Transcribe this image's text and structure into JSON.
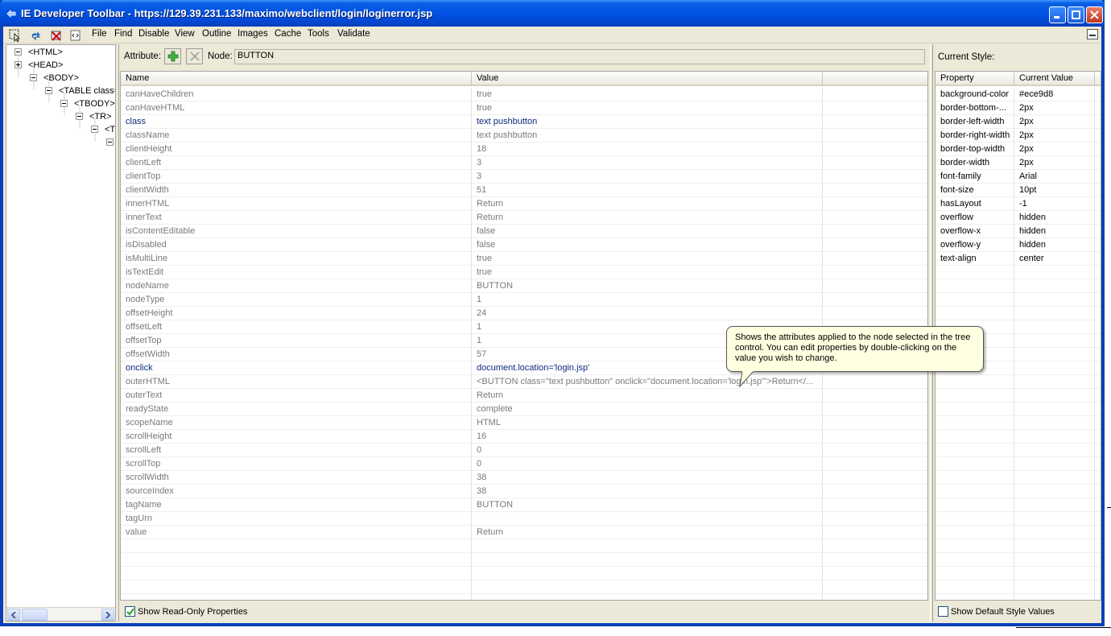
{
  "window": {
    "title": "IE Developer Toolbar - https://129.39.231.133/maximo/webclient/login/loginerror.jsp"
  },
  "menu": {
    "icons": [
      "select-element-icon",
      "refresh-icon",
      "clear-cache-icon",
      "view-source-icon"
    ],
    "items": [
      "File",
      "Find",
      "Disable",
      "View",
      "Outline",
      "Images",
      "Cache",
      "Tools",
      "Validate"
    ]
  },
  "tree": {
    "nodes": [
      {
        "label": "<HTML>",
        "toggle": "minus"
      },
      {
        "label": "<HEAD>",
        "toggle": "plus"
      },
      {
        "label": "<BODY>",
        "toggle": "minus"
      },
      {
        "label": "<TABLE class=",
        "toggle": "minus"
      },
      {
        "label": "<TBODY>",
        "toggle": "minus"
      },
      {
        "label": "<TR>",
        "toggle": "minus"
      },
      {
        "label": "<T",
        "toggle": "minus"
      },
      {
        "label": "",
        "toggle": "minus"
      }
    ]
  },
  "attributes": {
    "attribute_label": "Attribute:",
    "node_label": "Node:",
    "node_value": "BUTTON",
    "columns": [
      "Name",
      "Value"
    ],
    "rows": [
      {
        "name": "canHaveChildren",
        "value": "true",
        "editable": false
      },
      {
        "name": "canHaveHTML",
        "value": "true",
        "editable": false
      },
      {
        "name": "class",
        "value": "text pushbutton",
        "editable": true
      },
      {
        "name": "className",
        "value": "text pushbutton",
        "editable": false
      },
      {
        "name": "clientHeight",
        "value": "18",
        "editable": false
      },
      {
        "name": "clientLeft",
        "value": "3",
        "editable": false
      },
      {
        "name": "clientTop",
        "value": "3",
        "editable": false
      },
      {
        "name": "clientWidth",
        "value": "51",
        "editable": false
      },
      {
        "name": "innerHTML",
        "value": "Return",
        "editable": false
      },
      {
        "name": "innerText",
        "value": "Return",
        "editable": false
      },
      {
        "name": "isContentEditable",
        "value": "false",
        "editable": false
      },
      {
        "name": "isDisabled",
        "value": "false",
        "editable": false
      },
      {
        "name": "isMultiLine",
        "value": "true",
        "editable": false
      },
      {
        "name": "isTextEdit",
        "value": "true",
        "editable": false
      },
      {
        "name": "nodeName",
        "value": "BUTTON",
        "editable": false
      },
      {
        "name": "nodeType",
        "value": "1",
        "editable": false
      },
      {
        "name": "offsetHeight",
        "value": "24",
        "editable": false
      },
      {
        "name": "offsetLeft",
        "value": "1",
        "editable": false
      },
      {
        "name": "offsetTop",
        "value": "1",
        "editable": false
      },
      {
        "name": "offsetWidth",
        "value": "57",
        "editable": false
      },
      {
        "name": "onclick",
        "value": "document.location='login.jsp'",
        "editable": true
      },
      {
        "name": "outerHTML",
        "value": "<BUTTON class=\"text pushbutton\" onclick=\"document.location='login.jsp'\">Return</...",
        "editable": false
      },
      {
        "name": "outerText",
        "value": "Return",
        "editable": false
      },
      {
        "name": "readyState",
        "value": "complete",
        "editable": false
      },
      {
        "name": "scopeName",
        "value": "HTML",
        "editable": false
      },
      {
        "name": "scrollHeight",
        "value": "16",
        "editable": false
      },
      {
        "name": "scrollLeft",
        "value": "0",
        "editable": false
      },
      {
        "name": "scrollTop",
        "value": "0",
        "editable": false
      },
      {
        "name": "scrollWidth",
        "value": "38",
        "editable": false
      },
      {
        "name": "sourceIndex",
        "value": "38",
        "editable": false
      },
      {
        "name": "tagName",
        "value": "BUTTON",
        "editable": false
      },
      {
        "name": "tagUrn",
        "value": "",
        "editable": false
      },
      {
        "name": "value",
        "value": "Return",
        "editable": false
      }
    ],
    "empty_rows": 5,
    "show_readonly_label": "Show Read-Only Properties",
    "show_readonly_checked": true
  },
  "style": {
    "title": "Current Style:",
    "columns": [
      "Property",
      "Current Value"
    ],
    "rows": [
      {
        "property": "background-color",
        "value": "#ece9d8"
      },
      {
        "property": "border-bottom-...",
        "value": "2px"
      },
      {
        "property": "border-left-width",
        "value": "2px"
      },
      {
        "property": "border-right-width",
        "value": "2px"
      },
      {
        "property": "border-top-width",
        "value": "2px"
      },
      {
        "property": "border-width",
        "value": "2px"
      },
      {
        "property": "font-family",
        "value": "Arial"
      },
      {
        "property": "font-size",
        "value": "10pt"
      },
      {
        "property": "hasLayout",
        "value": "-1"
      },
      {
        "property": "overflow",
        "value": "hidden"
      },
      {
        "property": "overflow-x",
        "value": "hidden"
      },
      {
        "property": "overflow-y",
        "value": "hidden"
      },
      {
        "property": "text-align",
        "value": "center"
      }
    ],
    "empty_rows": 25,
    "show_default_label": "Show Default Style Values",
    "show_default_checked": false
  },
  "tooltip": {
    "text": "Shows the attributes applied to the node selected in the tree control. You can edit properties by double-clicking on the value you wish to change."
  },
  "colors": {
    "titlebar": "#0054e3",
    "chrome": "#ece9d8",
    "editable_text": "#0d2b80",
    "readonly_text": "#7a7a7a",
    "tooltip_bg": "#ffffe1"
  }
}
